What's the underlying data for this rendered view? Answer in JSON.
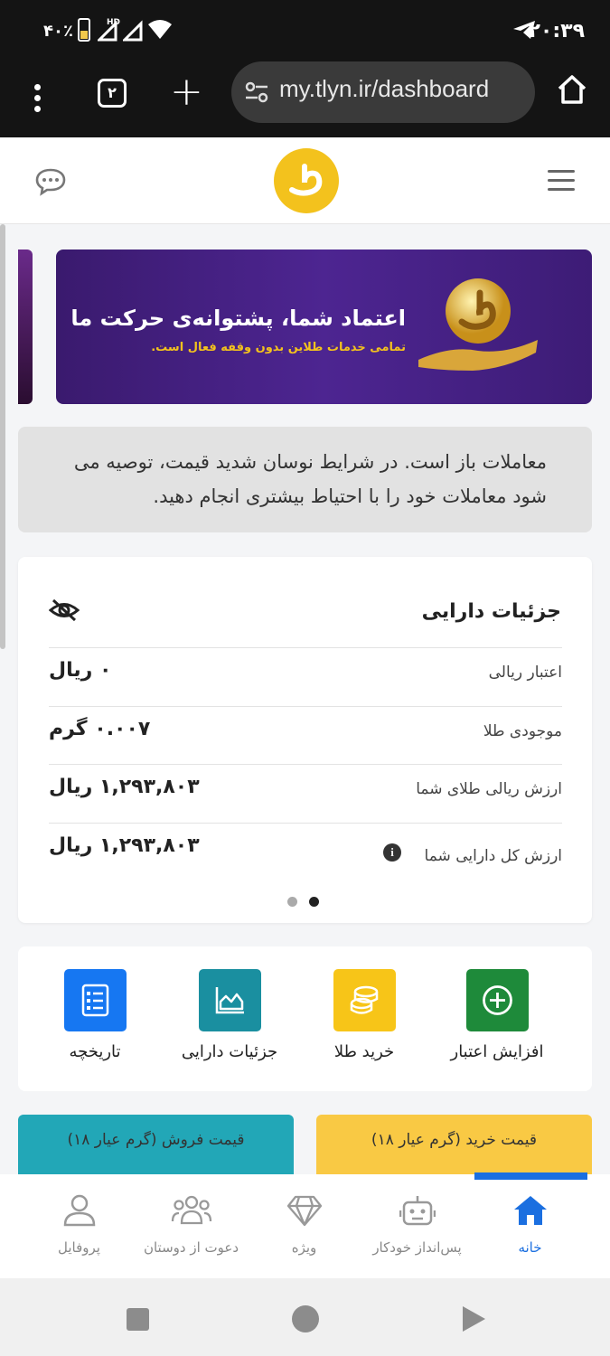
{
  "statusbar": {
    "time": "۲۰:۳۹",
    "battery_pct": "۴۰٪",
    "hd_label": "HD"
  },
  "browser": {
    "tab_count": "۲",
    "url": "my.tlyn.ir/dashboard"
  },
  "banner": {
    "title": "اعتماد شما، پشتوانه‌ی حرکت ما",
    "subtitle": "تمامی خدمات طلاین بدون وقفه فعال است."
  },
  "notice": {
    "text": "معاملات باز است. در شرایط نوسان شدید قیمت، توصیه می شود معاملات خود را با احتیاط بیشتری انجام دهید."
  },
  "assets": {
    "title": "جزئیات دارایی",
    "rows": [
      {
        "label": "اعتبار ریالی",
        "value": "۰ ریال"
      },
      {
        "label": "موجودی طلا",
        "value": "۰.۰۰۷ گرم"
      },
      {
        "label": "ارزش ریالی طلای شما",
        "value": "۱,۲۹۳,۸۰۳ ریال"
      },
      {
        "label": "ارزش کل دارایی شما",
        "value": "۱,۲۹۳,۸۰۳ ریال"
      }
    ]
  },
  "actions": [
    {
      "label": "افزایش اعتبار",
      "icon": "plus-circle-icon",
      "color": "#1e8a3a"
    },
    {
      "label": "خرید طلا",
      "icon": "coins-icon",
      "color": "#f7c518"
    },
    {
      "label": "جزئیات دارایی",
      "icon": "chart-icon",
      "color": "#1a8fa0"
    },
    {
      "label": "تاریخچه",
      "icon": "list-icon",
      "color": "#1677f2"
    }
  ],
  "prices": {
    "buy_label": "قیمت خرید (گرم عیار ۱۸)",
    "sell_label": "قیمت فروش (گرم عیار ۱۸)"
  },
  "bottomnav": [
    {
      "label": "خانه",
      "icon": "home-icon",
      "active": true
    },
    {
      "label": "پس‌انداز خودکار",
      "icon": "robot-icon",
      "active": false
    },
    {
      "label": "ویژه",
      "icon": "diamond-icon",
      "active": false
    },
    {
      "label": "دعوت از دوستان",
      "icon": "users-icon",
      "active": false
    },
    {
      "label": "پروفایل",
      "icon": "user-icon",
      "active": false
    }
  ],
  "colors": {
    "brand_gold": "#f3c21d",
    "active_blue": "#1b6fe0"
  }
}
